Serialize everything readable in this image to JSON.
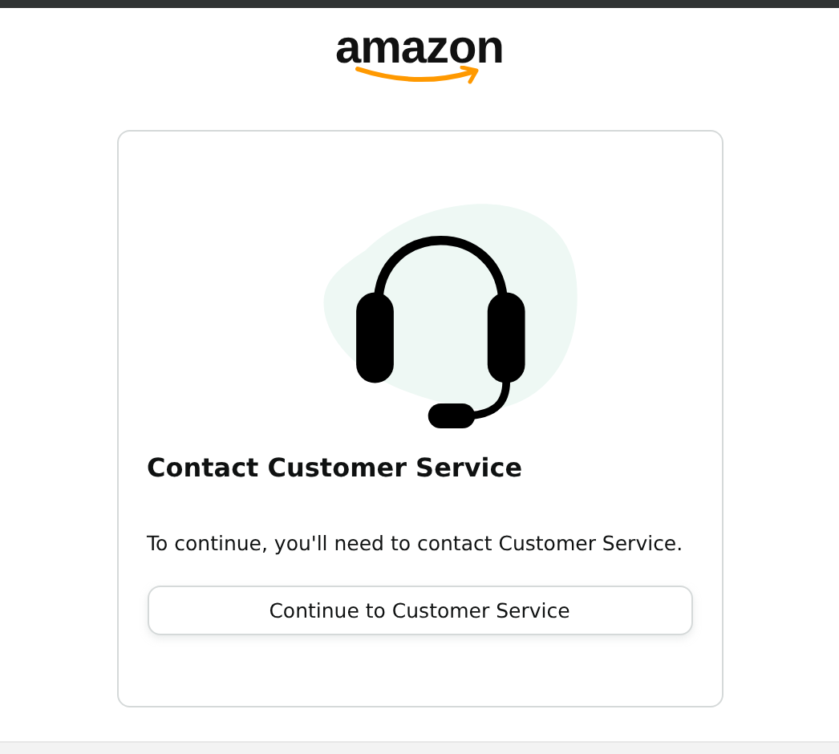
{
  "logo": {
    "text": "amazon"
  },
  "card": {
    "title": "Contact Customer Service",
    "message": "To continue, you'll need to contact Customer Service.",
    "button": "Continue to Customer Service"
  }
}
